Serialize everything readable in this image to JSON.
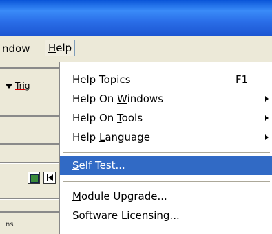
{
  "menubar": {
    "window_label": "ndow",
    "help_label": "Help",
    "help_mnemonic": "H",
    "help_rest": "elp"
  },
  "toolbar": {
    "trigger_label": "Trig"
  },
  "status": {
    "fragment": "ns"
  },
  "help_menu": {
    "items": [
      {
        "pre": "",
        "mn": "H",
        "post": "elp Topics",
        "shortcut": "F1",
        "submenu": false
      },
      {
        "pre": "Help On ",
        "mn": "W",
        "post": "indows",
        "shortcut": "",
        "submenu": true
      },
      {
        "pre": "Help On ",
        "mn": "T",
        "post": "ools",
        "shortcut": "",
        "submenu": true
      },
      {
        "pre": "Help ",
        "mn": "L",
        "post": "anguage",
        "shortcut": "",
        "submenu": true
      },
      {
        "pre": "",
        "mn": "S",
        "post": "elf Test...",
        "shortcut": "",
        "submenu": false
      },
      {
        "pre": "",
        "mn": "M",
        "post": "odule Upgrade...",
        "shortcut": "",
        "submenu": false
      },
      {
        "pre": "S",
        "mn": "o",
        "post": "ftware Licensing...",
        "shortcut": "",
        "submenu": false
      }
    ],
    "selected_index": 4
  },
  "colors": {
    "selection": "#316ac5",
    "menubar_bg": "#ece9d8",
    "titlebar": "#2a6ee8"
  }
}
